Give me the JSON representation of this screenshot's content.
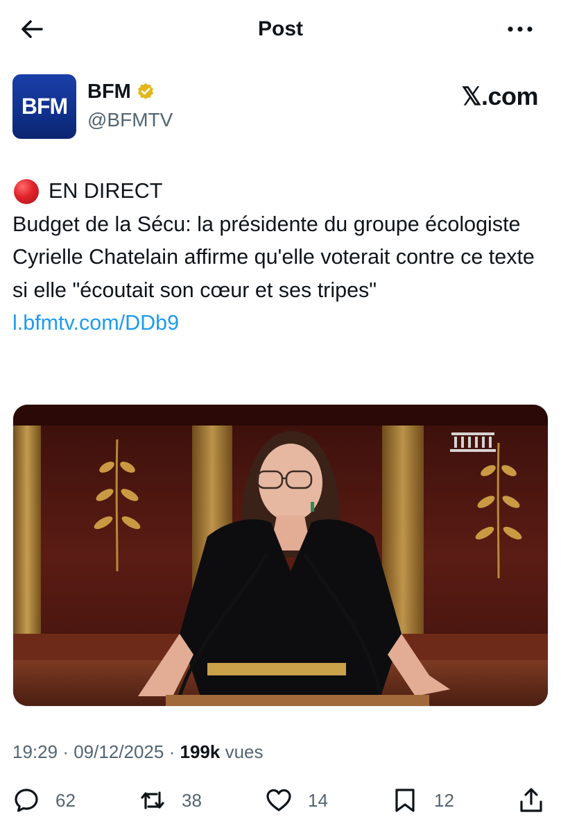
{
  "header": {
    "title": "Post",
    "back_icon": "arrow-left-icon",
    "more_icon": "more-horizontal-icon"
  },
  "author": {
    "avatar_text": "BFM",
    "name": "BFM",
    "handle": "@BFMTV",
    "verified_icon": "verified-gold-badge-icon"
  },
  "source": {
    "domain": "𝕏.com"
  },
  "post": {
    "live_label": "EN DIRECT",
    "body": "Budget de la Sécu: la présidente du groupe écologiste Cyrielle Chatelain affirme qu'elle voterait contre ce texte si elle \"écoutait son cœur et ses tripes\"",
    "link": "l.bfmtv.com/DDb9"
  },
  "meta": {
    "time": "19:29",
    "date": "09/12/2025",
    "views_count": "199k",
    "views_label": "vues",
    "separator": "·"
  },
  "actions": {
    "replies": "62",
    "reposts": "38",
    "likes": "14",
    "bookmarks": "12"
  },
  "colors": {
    "accent_link": "#1d9bf0",
    "text_secondary": "#536471",
    "avatar_bg": "#1a3fa8",
    "live_dot": "#e0222a"
  }
}
